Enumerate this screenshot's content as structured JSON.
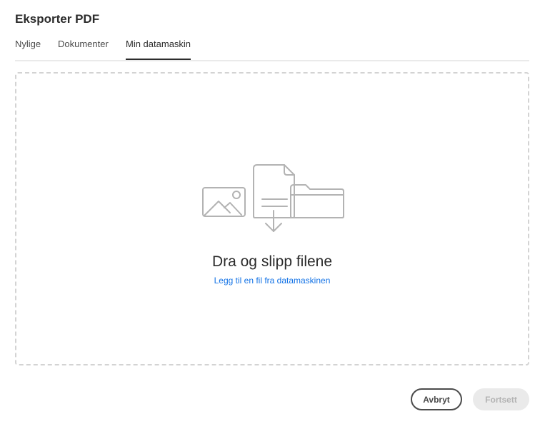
{
  "dialog": {
    "title": "Eksporter PDF"
  },
  "tabs": [
    {
      "label": "Nylige"
    },
    {
      "label": "Dokumenter"
    },
    {
      "label": "Min datamaskin",
      "active": true
    }
  ],
  "drop_zone": {
    "title": "Dra og slipp filene",
    "link": "Legg til en fil fra datamaskinen",
    "icons": [
      "image-icon",
      "file-upload-icon",
      "folder-icon"
    ]
  },
  "buttons": {
    "cancel": "Avbryt",
    "continue": "Fortsett",
    "continue_disabled": true
  },
  "colors": {
    "link": "#1473e6",
    "icon_stroke": "#b3b3b3",
    "active_tab": "#2c2c2c"
  }
}
